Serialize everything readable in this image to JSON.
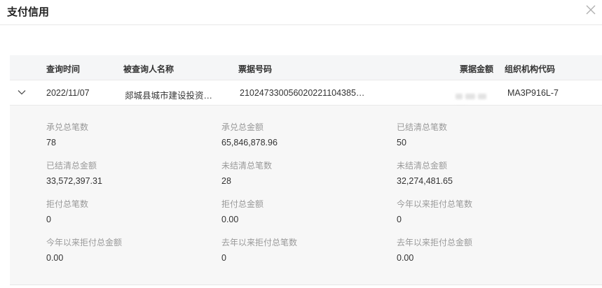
{
  "dialog": {
    "title": "支付信用"
  },
  "table": {
    "headers": {
      "query_time": "查询时间",
      "queried_name": "被查询人名称",
      "bill_number": "票据号码",
      "bill_amount": "票据金额",
      "org_code": "组织机构代码"
    },
    "row": {
      "query_time": "2022/11/07",
      "queried_name": "郯城县城市建设投资…",
      "bill_number": "2102473300560202211043​85…",
      "org_code": "MA3P916L-7"
    }
  },
  "details": [
    {
      "label": "承兑总笔数",
      "value": "78"
    },
    {
      "label": "承兑总金额",
      "value": "65,846,878.96"
    },
    {
      "label": "已结清总笔数",
      "value": "50"
    },
    {
      "label": "已结清总金额",
      "value": "33,572,397.31"
    },
    {
      "label": "未结清总笔数",
      "value": "28"
    },
    {
      "label": "未结清总金额",
      "value": "32,274,481.65"
    },
    {
      "label": "拒付总笔数",
      "value": "0"
    },
    {
      "label": "拒付总金额",
      "value": "0.00"
    },
    {
      "label": "今年以来拒付总笔数",
      "value": "0"
    },
    {
      "label": "今年以来拒付总金额",
      "value": "0.00"
    },
    {
      "label": "去年以来拒付总笔数",
      "value": "0"
    },
    {
      "label": "去年以来拒付总金额",
      "value": "0.00"
    }
  ],
  "icons": {
    "close": "close-icon",
    "expand": "chevron-down-icon"
  }
}
